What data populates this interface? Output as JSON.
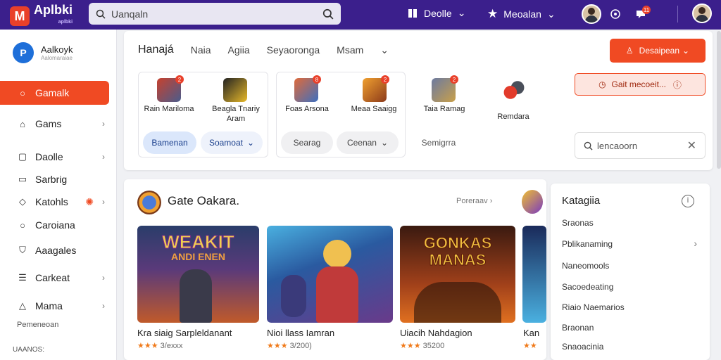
{
  "topbar": {
    "logo_text": "Aplbki",
    "logo_sub": "aplbki",
    "search_placeholder": "Uanqaln",
    "menu1_label": "Deolle",
    "menu2_label": "Meoalan",
    "notif_count": "11"
  },
  "sidebar": {
    "brand_name": "Aalkoyk",
    "brand_sub": "Aalomaraiae",
    "items": [
      {
        "label": "Gamalk"
      },
      {
        "label": "Gams"
      },
      {
        "label": "Daolle"
      },
      {
        "label": "Sarbrig"
      },
      {
        "label": "Katohls"
      },
      {
        "label": "Caroiana"
      },
      {
        "label": "Aaagales"
      },
      {
        "label": "Carkeat"
      },
      {
        "label": "Mama"
      }
    ],
    "footer1": "Pemeneoan",
    "footer2": "UAANOS:"
  },
  "main": {
    "tabs": [
      "Hanajá",
      "Naia",
      "Agiia",
      "Seyaoronga",
      "Msam"
    ],
    "primary_button": "Desaipean",
    "outline_button": "Gait mecoeit...",
    "filter_placeholder": "lencaoorn",
    "groups": [
      {
        "label": "Rain Mariloma"
      },
      {
        "label": "Beagla Tnariy Aram"
      },
      {
        "label": "Foas Arsona"
      },
      {
        "label": "Meaa Saaigg"
      },
      {
        "label": "Taia Ramag"
      },
      {
        "label": "Remdara"
      }
    ],
    "pills": [
      "Bamenan",
      "Soamoat",
      "Searag",
      "Ceenan"
    ],
    "pill_plain": "Semigrra"
  },
  "featured": {
    "title": "Gate Oakara.",
    "more": "Poreraav",
    "games": [
      {
        "title": "Kra siaig Sarpleldanant",
        "rating": "3/exxx",
        "art_title": "WEAKIT",
        "art_sub": "ANDI ENEN"
      },
      {
        "title": "Nioi llass Iamran",
        "rating": "3/200)",
        "art_title": "",
        "art_sub": ""
      },
      {
        "title": "Uiacih Nahdagion",
        "rating": "35200",
        "art_title": "GONKAS",
        "art_sub": "MANAS"
      },
      {
        "title": "Kan",
        "rating": "",
        "art_title": "",
        "art_sub": ""
      }
    ]
  },
  "categories": {
    "title": "Katagiia",
    "items": [
      "Sraonas",
      "Pblikanaming",
      "Naneomools",
      "Sacoedeating",
      "Riaio Naemarios",
      "Braonan",
      "Snaoacinia"
    ]
  },
  "colors": {
    "topbar": "#3b1f8c",
    "accent": "#f04a23"
  }
}
